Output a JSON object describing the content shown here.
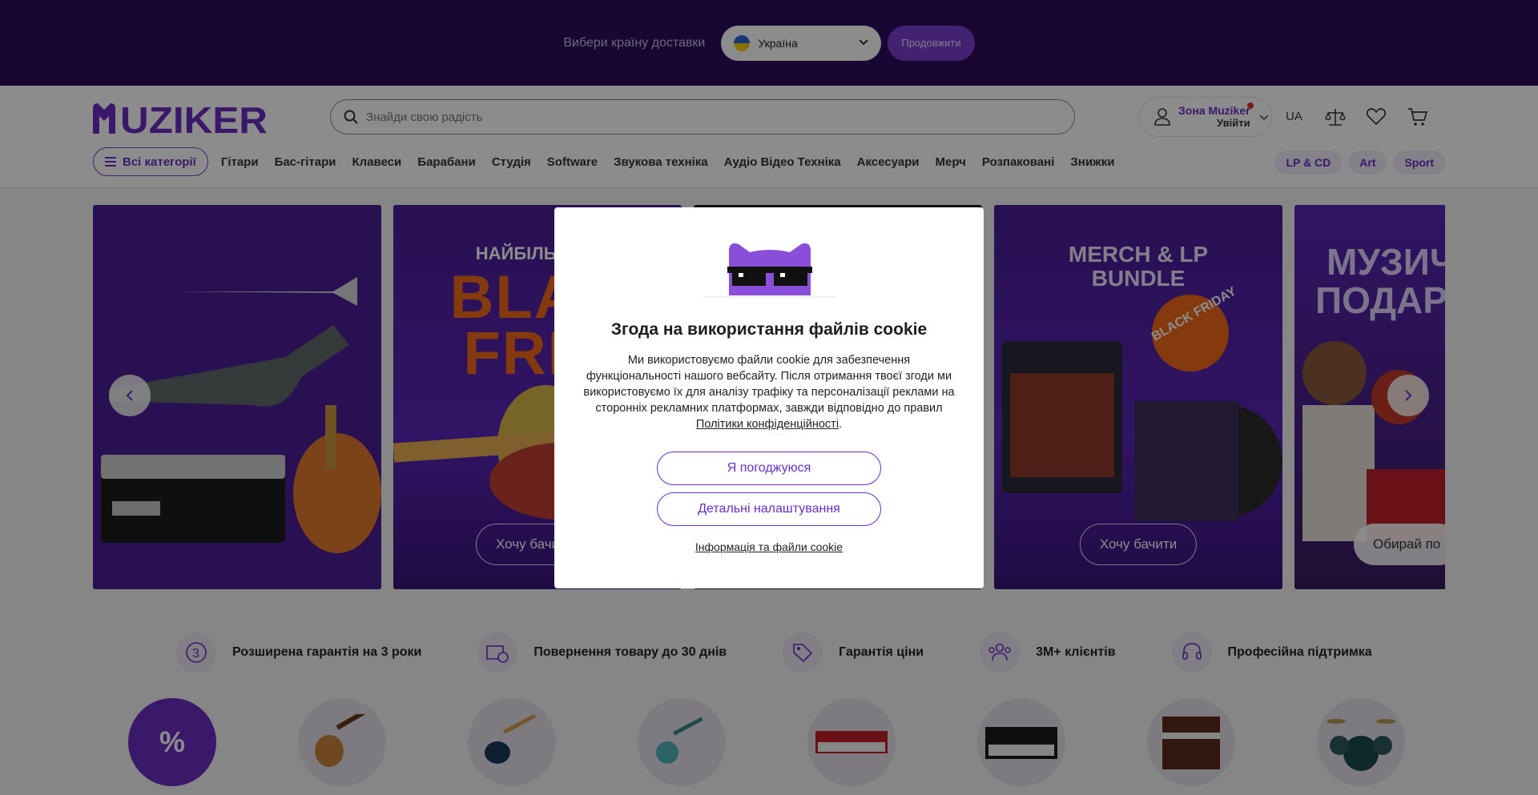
{
  "country_bar": {
    "label": "Вибери країну доставки",
    "selected_country": "Україна",
    "continue_label": "Продовжити"
  },
  "header": {
    "logo_text": "MUZIKER",
    "search_placeholder": "Знайди свою радість",
    "account_zone": "Зона Muziker",
    "account_login": "Увійти",
    "language": "UA"
  },
  "nav": {
    "all_categories": "Всі категорії",
    "items": [
      "Гітари",
      "Бас-гітари",
      "Клавеси",
      "Барабани",
      "Студія",
      "Software",
      "Звукова техніка",
      "Аудіо Відео Техніка",
      "Аксесуари",
      "Мерч",
      "Розпаковані",
      "Знижки"
    ],
    "right_pills": [
      "LP & CD",
      "Art",
      "Sport"
    ]
  },
  "banners": {
    "b2_line1": "НАЙБІЛЬШИЙ",
    "b2_line2": "BLAC",
    "b2_line3": "FRID",
    "b2_button": "Хочу бачи",
    "b4_title1": "MERCH & LP",
    "b4_title2": "BUNDLE",
    "b4_badge": "BLACK FRIDAY",
    "b4_button": "Хочу бачити",
    "b5_title1": "МУЗИЧ",
    "b5_title2": "ПОДАР",
    "b5_button": "Обирай по"
  },
  "benefits": [
    {
      "icon": "warranty-3-icon",
      "text": "Розширена гарантія на 3 роки"
    },
    {
      "icon": "return-box-icon",
      "text": "Повернення товару до 30 днів"
    },
    {
      "icon": "price-tag-icon",
      "text": "Гарантія ціни"
    },
    {
      "icon": "customers-icon",
      "text": "3M+ клієнтів"
    },
    {
      "icon": "headset-support-icon",
      "text": "Професійна підтримка"
    }
  ],
  "categories": [
    "sale-percent-icon",
    "acoustic-guitar-image",
    "electric-guitar-image",
    "ukulele-image",
    "stage-piano-image",
    "keyboard-image",
    "digital-piano-image",
    "drum-kit-image"
  ],
  "cookie_modal": {
    "title": "Згода на використання файлів cookie",
    "body": "Ми використовуємо файли cookie для забезпечення функціональності нашого вебсайту. Після отримання твоєї згоди ми використовуємо їх для аналізу трафіку та персоналізації реклами на сторонніх рекламних платформах, завжди відповідно до правил",
    "policy_link": "Політики конфіденційності",
    "accept_label": "Я погоджуюся",
    "settings_label": "Детальні налаштування",
    "info_link": "Інформація та файли cookie"
  },
  "colors": {
    "brand_purple": "#6a2fc4",
    "top_bar": "#2a0d5c",
    "accent_orange": "#f26a1b"
  }
}
